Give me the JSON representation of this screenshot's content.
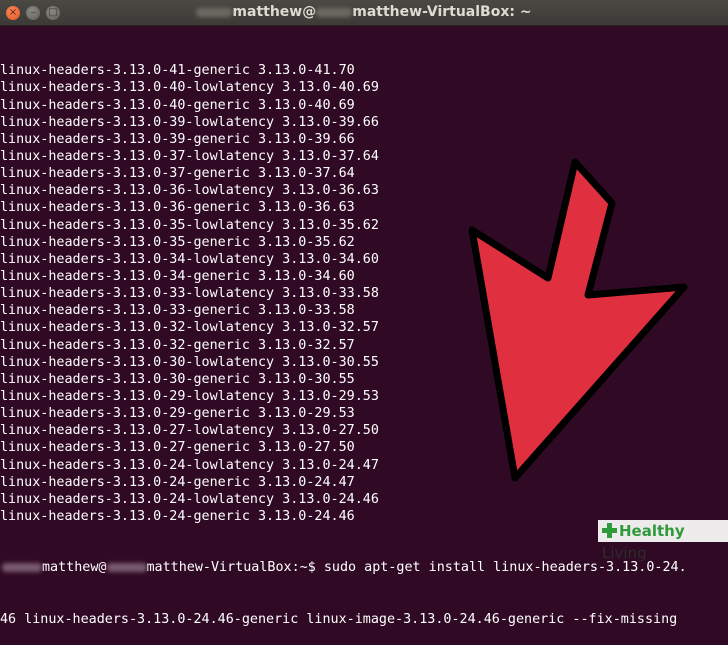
{
  "window": {
    "title_user": "matthew@",
    "title_host": "matthew-VirtualBox: ~",
    "close_symbol": "×",
    "minimize_symbol": "–",
    "maximize_symbol": "□"
  },
  "terminal": {
    "lines": [
      "linux-headers-3.13.0-41-generic 3.13.0-41.70",
      "linux-headers-3.13.0-40-lowlatency 3.13.0-40.69",
      "linux-headers-3.13.0-40-generic 3.13.0-40.69",
      "linux-headers-3.13.0-39-lowlatency 3.13.0-39.66",
      "linux-headers-3.13.0-39-generic 3.13.0-39.66",
      "linux-headers-3.13.0-37-lowlatency 3.13.0-37.64",
      "linux-headers-3.13.0-37-generic 3.13.0-37.64",
      "linux-headers-3.13.0-36-lowlatency 3.13.0-36.63",
      "linux-headers-3.13.0-36-generic 3.13.0-36.63",
      "linux-headers-3.13.0-35-lowlatency 3.13.0-35.62",
      "linux-headers-3.13.0-35-generic 3.13.0-35.62",
      "linux-headers-3.13.0-34-lowlatency 3.13.0-34.60",
      "linux-headers-3.13.0-34-generic 3.13.0-34.60",
      "linux-headers-3.13.0-33-lowlatency 3.13.0-33.58",
      "linux-headers-3.13.0-33-generic 3.13.0-33.58",
      "linux-headers-3.13.0-32-lowlatency 3.13.0-32.57",
      "linux-headers-3.13.0-32-generic 3.13.0-32.57",
      "linux-headers-3.13.0-30-lowlatency 3.13.0-30.55",
      "linux-headers-3.13.0-30-generic 3.13.0-30.55",
      "linux-headers-3.13.0-29-lowlatency 3.13.0-29.53",
      "linux-headers-3.13.0-29-generic 3.13.0-29.53",
      "linux-headers-3.13.0-27-lowlatency 3.13.0-27.50",
      "linux-headers-3.13.0-27-generic 3.13.0-27.50",
      "linux-headers-3.13.0-24-lowlatency 3.13.0-24.47",
      "linux-headers-3.13.0-24-generic 3.13.0-24.47",
      "linux-headers-3.13.0-24-lowlatency 3.13.0-24.46",
      "linux-headers-3.13.0-24-generic 3.13.0-24.46"
    ],
    "prompt_user": "matthew@",
    "prompt_host_path": "matthew-VirtualBox:~$ ",
    "command": "sudo apt-get install linux-headers-3.13.0-24.",
    "command_continuation": "46 linux-headers-3.13.0-24.46-generic linux-image-3.13.0-24.46-generic --fix-missing"
  },
  "overlay": {
    "arrow_color": "#e0303f",
    "watermark_brand": "Healthy",
    "watermark_word": "Living"
  }
}
